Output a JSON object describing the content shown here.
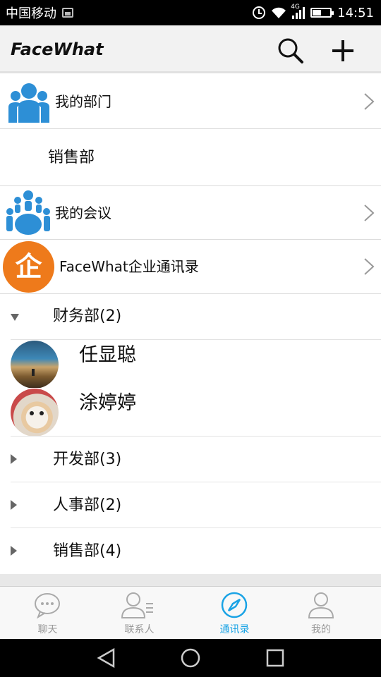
{
  "status_bar": {
    "carrier": "中国移动",
    "network": "4G",
    "time": "14:51"
  },
  "app_bar": {
    "title": "FaceWhat",
    "icons": [
      "search-icon",
      "plus-icon"
    ]
  },
  "entries": {
    "my_department": "我的部门",
    "department_name": "销售部",
    "my_meetings": "我的会议",
    "enterprise_directory": "FaceWhat企业通讯录",
    "enterprise_logo_char": "企"
  },
  "groups": {
    "expanded": {
      "label": "财务部(2)",
      "contacts": [
        {
          "name": "任显聪"
        },
        {
          "name": "涂婷婷"
        }
      ]
    },
    "collapsed": [
      {
        "label": "开发部(3)"
      },
      {
        "label": "人事部(2)"
      },
      {
        "label": "销售部(4)"
      }
    ]
  },
  "tabs": [
    {
      "label": "聊天",
      "icon": "chat-icon",
      "active": false
    },
    {
      "label": "联系人",
      "icon": "contacts-icon",
      "active": false
    },
    {
      "label": "通讯录",
      "icon": "compass-icon",
      "active": true
    },
    {
      "label": "我的",
      "icon": "person-icon",
      "active": false
    }
  ],
  "colors": {
    "accent_blue": "#1aa3e5",
    "icon_blue": "#2d8fd6",
    "logo_orange": "#ee7a1b",
    "inactive_gray": "#999999"
  }
}
